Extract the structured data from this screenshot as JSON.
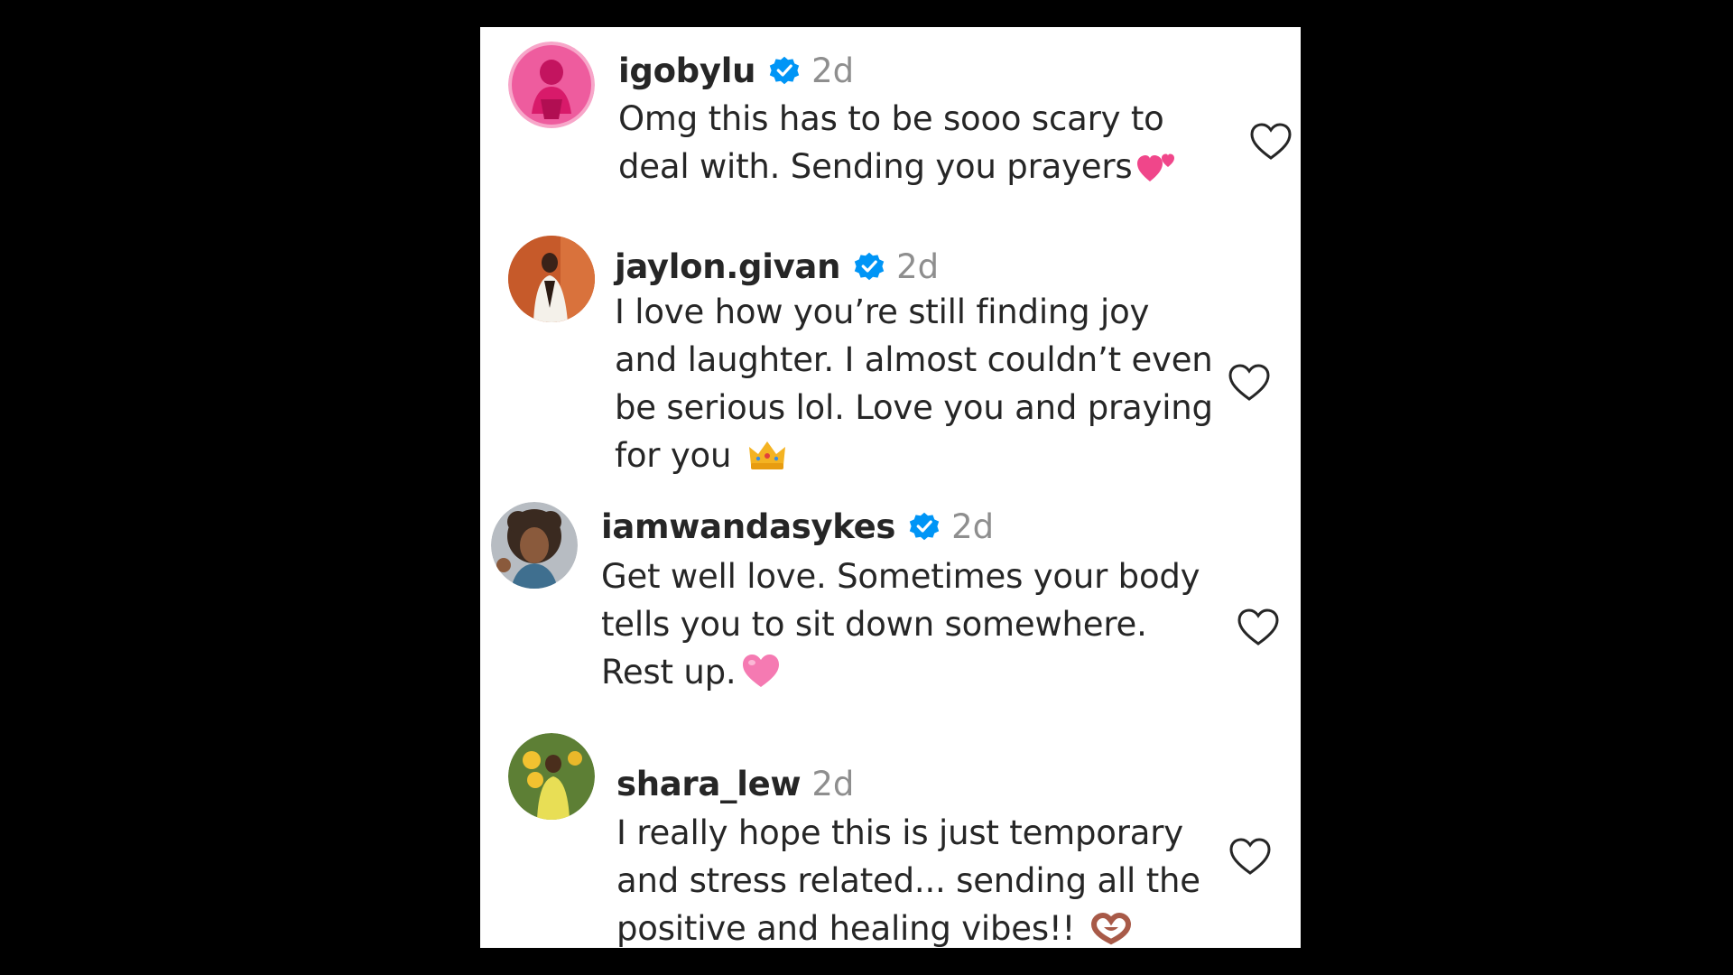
{
  "comments": [
    {
      "username": "igobylu",
      "verified": true,
      "time": "2d",
      "lines": [
        "Omg this has to be sooo scary to",
        "deal with. Sending you prayers"
      ],
      "emoji": "two-hearts-emoji",
      "avatar_colors": [
        "#f0569b",
        "#d6176d"
      ]
    },
    {
      "username": "jaylon.givan",
      "verified": true,
      "time": "2d",
      "lines": [
        "I love how you’re still finding joy",
        "and laughter. I almost couldn’t even",
        "be serious lol. Love you and praying",
        "for you"
      ],
      "emoji": "crown-emoji",
      "avatar_colors": [
        "#c0562a",
        "#f2f0ea"
      ]
    },
    {
      "username": "iamwandasykes",
      "verified": true,
      "time": "2d",
      "lines": [
        "Get well love. Sometimes your body",
        "tells you to sit down somewhere.",
        "Rest up."
      ],
      "emoji": "pink-heart-emoji",
      "avatar_colors": [
        "#5a4638",
        "#a8b0b8"
      ]
    },
    {
      "username": "shara_lew",
      "verified": false,
      "time": "2d",
      "lines": [
        "I really hope this is just temporary",
        "and stress related... sending all the",
        "positive and healing vibes!!"
      ],
      "emoji": "heart-hands-emoji",
      "avatar_colors": [
        "#6b8a3a",
        "#e8d95a"
      ]
    }
  ],
  "colors": {
    "background": "#000000",
    "panel": "#ffffff",
    "text": "#262626",
    "muted": "#8e8e8e",
    "verified": "#0095f6"
  }
}
